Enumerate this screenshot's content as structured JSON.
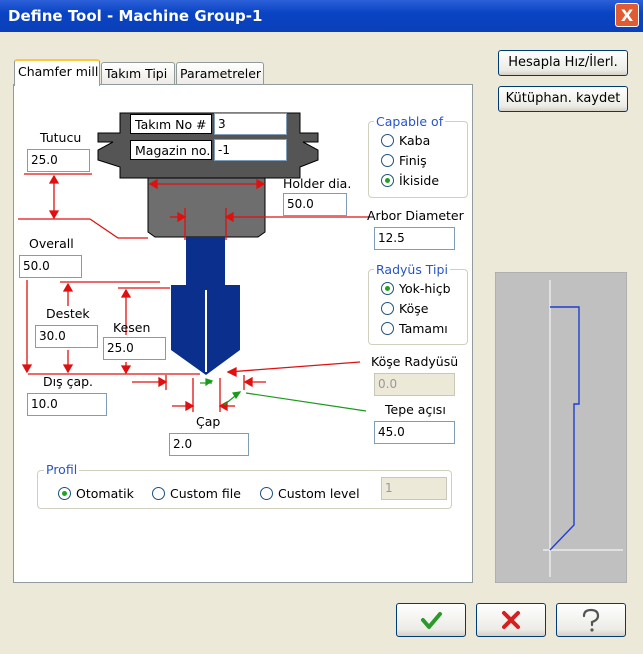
{
  "window": {
    "title": "Define Tool - Machine Group-1",
    "close": "X"
  },
  "tabs": [
    {
      "label": "Chamfer mill"
    },
    {
      "label": "Takım Tipi"
    },
    {
      "label": "Parametreler"
    }
  ],
  "right_buttons": {
    "calc": "Hesapla Hız/İlerl.",
    "save_library": "Kütüphan. kaydet"
  },
  "tool_header": {
    "tool_no_label": "Takım No #",
    "tool_no_value": "3",
    "magazine_label": "Magazin no.",
    "magazine_value": "-1"
  },
  "params": {
    "holder_label": "Tutucu",
    "holder_value": "25.0",
    "holder_dia_label": "Holder dia.",
    "holder_dia_value": "50.0",
    "arbor_label": "Arbor Diameter",
    "arbor_value": "12.5",
    "overall_label": "Overall",
    "overall_value": "50.0",
    "support_label": "Destek",
    "support_value": "30.0",
    "cut_label": "Kesen",
    "cut_value": "25.0",
    "outer_dia_label": "Dış çap.",
    "outer_dia_value": "10.0",
    "dia_label": "Çap",
    "dia_value": "2.0",
    "corner_radius_label": "Köşe Radyüsü",
    "corner_radius_value": "0.0",
    "tip_angle_label": "Tepe açısı",
    "tip_angle_value": "45.0"
  },
  "capable_of": {
    "legend": "Capable of",
    "options": [
      "Kaba",
      "Finiş",
      "İkiside"
    ],
    "selected": "İkiside"
  },
  "radius_type": {
    "legend": "Radyüs Tipi",
    "options": [
      "Yok-hiçb",
      "Köşe",
      "Tamamı"
    ],
    "selected": "Yok-hiçb"
  },
  "profile": {
    "legend": "Profil",
    "options": [
      "Otomatik",
      "Custom file",
      "Custom level"
    ],
    "selected": "Otomatik",
    "level_value": "1"
  },
  "colors": {
    "tool_blue": "#0a2f8c",
    "preview_line": "#1f3fd0",
    "dim_red": "#e01010",
    "ok_green": "#2a9a2a",
    "cancel_red": "#d42020"
  },
  "bottom_buttons": [
    {
      "name": "ok",
      "icon": "checkmark-icon"
    },
    {
      "name": "cancel",
      "icon": "x-mark-icon"
    },
    {
      "name": "help",
      "icon": "question-icon"
    }
  ]
}
